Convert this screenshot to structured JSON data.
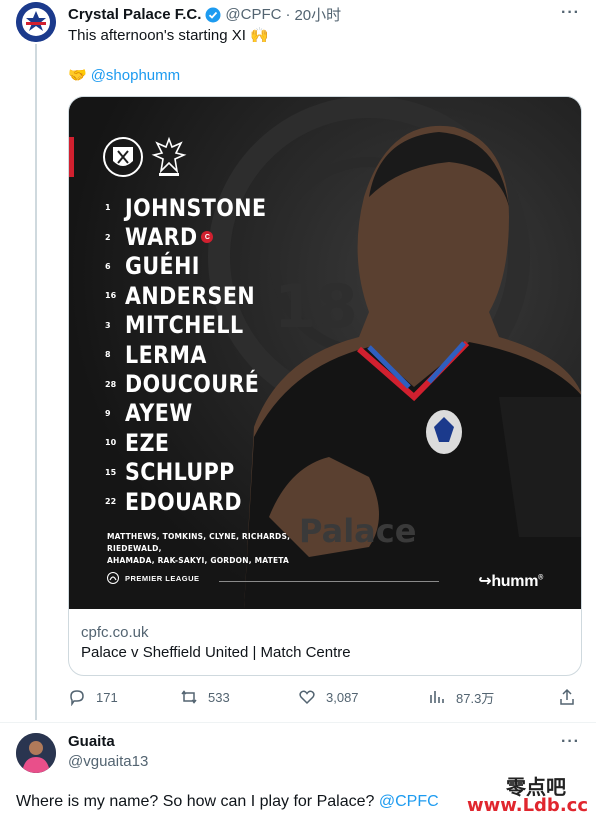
{
  "tweet": {
    "author": "Crystal Palace F.C.",
    "handle": "@CPFC",
    "separator": "·",
    "time": "20小时",
    "text": "This afternoon's starting XI 🙌",
    "promo_handle": "@shophumm",
    "card": {
      "domain": "cpfc.co.uk",
      "title": "Palace v Sheffield United | Match Centre",
      "poster": {
        "lineup": [
          {
            "number": "1",
            "name": "JOHNSTONE"
          },
          {
            "number": "2",
            "name": "WARD",
            "captain": "C"
          },
          {
            "number": "6",
            "name": "GUÉHI"
          },
          {
            "number": "16",
            "name": "ANDERSEN"
          },
          {
            "number": "3",
            "name": "MITCHELL"
          },
          {
            "number": "8",
            "name": "LERMA"
          },
          {
            "number": "28",
            "name": "DOUCOURÉ"
          },
          {
            "number": "9",
            "name": "AYEW"
          },
          {
            "number": "10",
            "name": "EZE"
          },
          {
            "number": "15",
            "name": "SCHLUPP"
          },
          {
            "number": "22",
            "name": "EDOUARD"
          }
        ],
        "subs_line1": "MATTHEWS, TOMKINS, CLYNE, RICHARDS, RIEDEWALD,",
        "subs_line2": "AHAMADA, RAK-SAKYI, GORDON, MATETA",
        "league": "PREMIER LEAGUE",
        "sponsor": "humm",
        "sponsor_mark": "®"
      }
    },
    "actions": {
      "replies": "171",
      "retweets": "533",
      "likes": "3,087",
      "views": "87.3万"
    }
  },
  "reply": {
    "author": "Guaita",
    "handle": "@vguaita13",
    "text": "Where is my name? So how can I play for Palace?",
    "mention": "@CPFC"
  },
  "watermark": {
    "line1": "零点吧",
    "line2": "www.Ldb.cc"
  },
  "colors": {
    "link": "#1d9bf0",
    "accent_red": "#d1202f",
    "muted": "#536471"
  }
}
